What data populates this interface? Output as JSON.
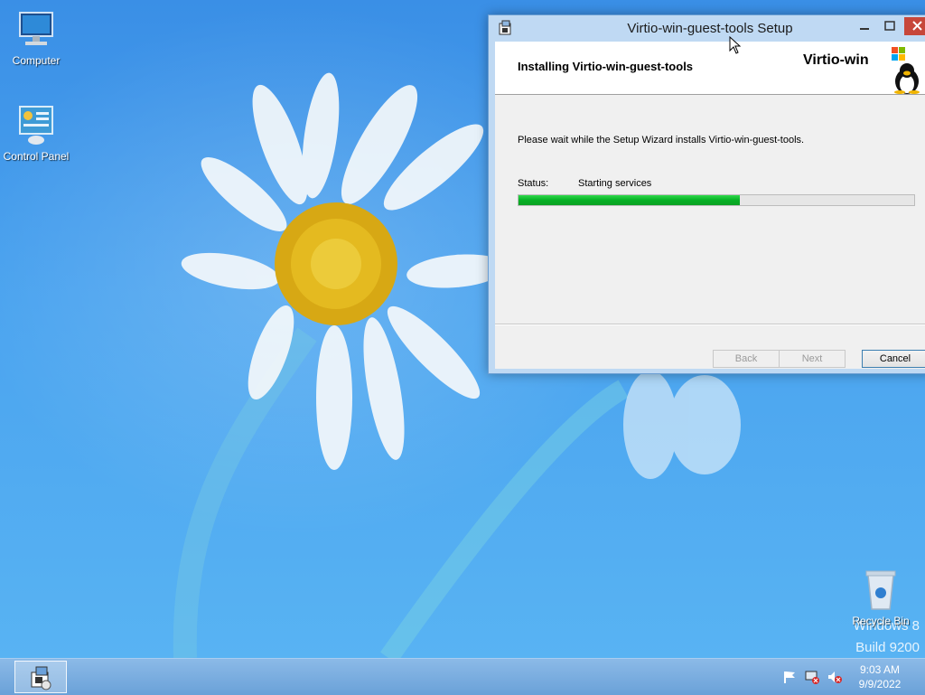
{
  "desktop": {
    "icons": [
      {
        "label": "Computer",
        "icon": "computer-icon"
      },
      {
        "label": "Control Panel",
        "icon": "control-panel-icon"
      },
      {
        "label": "Recycle Bin",
        "icon": "recycle-bin-icon"
      }
    ],
    "watermark": {
      "line1": "Windows 8",
      "line2": "Build 9200"
    }
  },
  "dialog": {
    "title": "Virtio-win-guest-tools Setup",
    "header_title": "Installing Virtio-win-guest-tools",
    "brand": "Virtio-win",
    "body_text": "Please wait while the Setup Wizard installs Virtio-win-guest-tools.",
    "status_label": "Status:",
    "status_value": "Starting services",
    "progress": 0.56,
    "buttons": {
      "back": "Back",
      "next": "Next",
      "cancel": "Cancel"
    }
  },
  "taskbar": {
    "active_app_icon": "installer-icon",
    "tray_icons": [
      "action-center-flag-icon",
      "network-disconnected-icon",
      "volume-muted-icon"
    ],
    "time": "9:03 AM",
    "date": "9/9/2022"
  },
  "colors": {
    "desktop_bg": "#4aa3ef",
    "progress_green": "#06b025",
    "titlebar": "#bfd9f3",
    "close_button": "#c7473a"
  }
}
